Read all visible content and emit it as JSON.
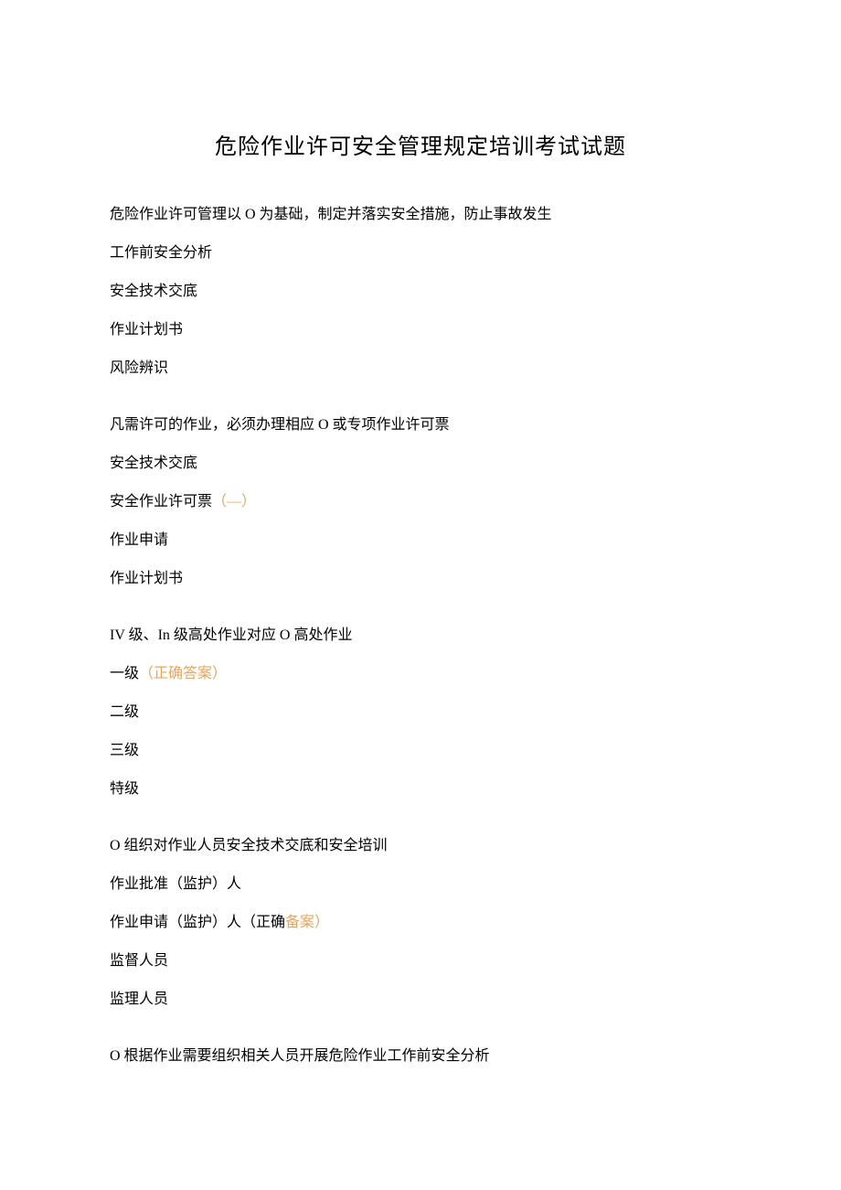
{
  "title": "危险作业许可安全管理规定培训考试试题",
  "q1": {
    "text": "危险作业许可管理以 O 为基础，制定并落实安全措施，防止事故发生",
    "opt1": "工作前安全分析",
    "opt2": "安全技术交底",
    "opt3": "作业计划书",
    "opt4": "风险辨识"
  },
  "q2": {
    "text": "凡需许可的作业，必须办理相应 O 或专项作业许可票",
    "opt1": "安全技术交底",
    "opt2_prefix": "安全作业许可票",
    "opt2_highlight": "（—）",
    "opt3": "作业申请",
    "opt4": "作业计划书"
  },
  "q3": {
    "text": "IV 级、In 级高处作业对应 O 高处作业",
    "opt1_prefix": "一级",
    "opt1_highlight": "（正确答案）",
    "opt2": "二级",
    "opt3": "三级",
    "opt4": "特级"
  },
  "q4": {
    "text": "O 组织对作业人员安全技术交底和安全培训",
    "opt1": "作业批准（监护）人",
    "opt2_prefix": "作业申请（监护）人（正确",
    "opt2_highlight": "备案）",
    "opt3": "监督人员",
    "opt4": "监理人员"
  },
  "q5": {
    "text": "O 根据作业需要组织相关人员开展危险作业工作前安全分析"
  }
}
